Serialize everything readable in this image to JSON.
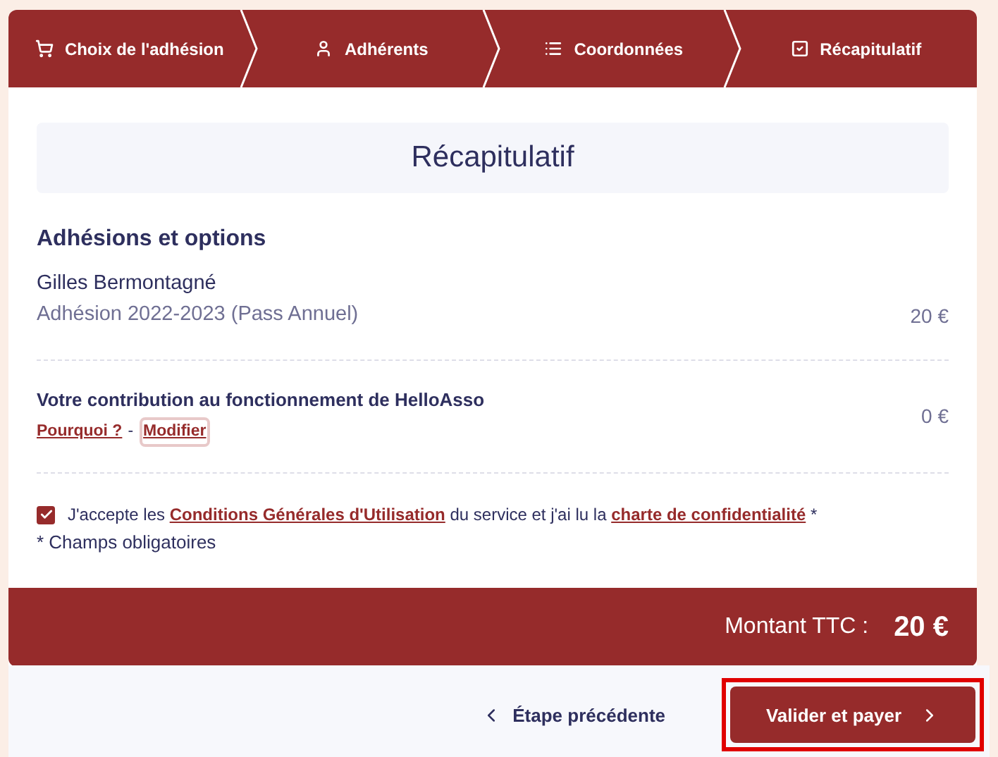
{
  "steps": [
    {
      "kind": "cart",
      "label": "Choix de l'adhésion"
    },
    {
      "kind": "person",
      "label": "Adhérents"
    },
    {
      "kind": "list",
      "label": "Coordonnées"
    },
    {
      "kind": "check",
      "label": "Récapitulatif"
    }
  ],
  "title": "Récapitulatif",
  "section_title": "Adhésions et options",
  "member": {
    "name": "Gilles Bermontagné",
    "item": "Adhésion 2022-2023 (Pass Annuel)",
    "price": "20 €"
  },
  "contribution": {
    "title": "Votre contribution au fonctionnement de HelloAsso",
    "why_link": "Pourquoi ?",
    "separator": "-",
    "edit_link": "Modifier",
    "price": "0 €"
  },
  "terms": {
    "checked": true,
    "text_1": "J'accepte les",
    "link_1": "Conditions Générales d'Utilisation",
    "text_2": "du service et j'ai lu la",
    "link_2": "charte de confidentialité",
    "mark": "*"
  },
  "required_note": "* Champs obligatoires",
  "total": {
    "label": "Montant TTC :",
    "amount": "20 €"
  },
  "back_button": "Étape précédente",
  "pay_button": "Valider et payer"
}
